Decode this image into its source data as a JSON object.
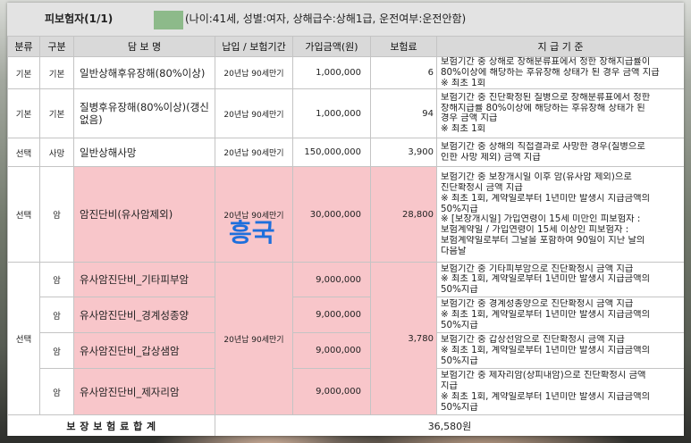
{
  "colors": {
    "band_bg": "#e3e3e3",
    "header_bg": "#d9d9d9",
    "highlight": "#f8c6ca",
    "redaction": "#8dba8a",
    "watermark": "#1e6fdc",
    "border": "#c4c4c4"
  },
  "insured": {
    "title": "피보험자(1/1)",
    "details": "(나이:41세, 성별:여자, 상해급수:상해1급, 운전여부:운전안함)"
  },
  "columns": {
    "category": "분류",
    "type": "구분",
    "coverage": "담 보 명",
    "term": "납입 / 보험기간",
    "amount": "가입금액(원)",
    "premium": "보험료",
    "criteria": "지 급 기 준"
  },
  "rows": [
    {
      "category": "기본",
      "type": "기본",
      "coverage": "일반상해후유장해(80%이상)",
      "term": "20년납 90세만기",
      "amount": "1,000,000",
      "premium": "6",
      "criteria": [
        "보험기간 중 상해로 장해분류표에서 정한 장해지급률이",
        "80%이상에 해당하는 후유장해 상태가 된 경우 금액 지급",
        "※ 최초 1회"
      ]
    },
    {
      "category": "기본",
      "type": "기본",
      "coverage": "질병후유장해(80%이상)(갱신없음)",
      "term": "20년납 90세만기",
      "amount": "1,000,000",
      "premium": "94",
      "criteria": [
        "보험기간 중 진단확정된 질병으로 장해분류표에서 정한",
        "장해지급률 80%이상에 해당하는 후유장해 상태가 된",
        "경우 금액 지급",
        "※ 최초 1회"
      ]
    },
    {
      "category": "선택",
      "type": "사망",
      "coverage": "일반상해사망",
      "term": "20년납 90세만기",
      "amount": "150,000,000",
      "premium": "3,900",
      "criteria": [
        "보험기간 중 상해의 직접결과로 사망한 경우(질병으로",
        "인한 사망 제외) 금액 지급"
      ]
    },
    {
      "category": "선택",
      "type": "암",
      "coverage": "암진단비(유사암제외)",
      "term": "20년납 90세만기",
      "amount": "30,000,000",
      "premium": "28,800",
      "criteria": [
        "보험기간 중 보장개시일 이후 암(유사암 제외)으로",
        "진단확정시 금액 지급",
        "※ 최초 1회, 계약일로부터 1년미만 발생시 지급금액의",
        "50%지급",
        "※ [보장개시일] 가입연령이 15세 미만인 피보험자 :",
        "보험계약일 / 가입연령이 15세 이상인 피보험자 :",
        "보험계약일로부터 그날을 포함하여 90일이 지난 날의",
        "다음날"
      ]
    }
  ],
  "group": {
    "category": "선택",
    "term": "20년납 90세만기",
    "premium": "3,780",
    "items": [
      {
        "type": "암",
        "coverage": "유사암진단비_기타피부암",
        "amount": "9,000,000",
        "criteria": [
          "보험기간 중 기타피부암으로 진단확정시 금액 지급",
          "※ 최초 1회, 계약일로부터 1년미만 발생시 지급금액의",
          "50%지급"
        ]
      },
      {
        "type": "암",
        "coverage": "유사암진단비_경계성종양",
        "amount": "9,000,000",
        "criteria": [
          "보험기간 중 경계성종양으로 진단확정시 금액 지급",
          "※ 최초 1회, 계약일로부터 1년미만 발생시 지급금액의",
          "50%지급"
        ]
      },
      {
        "type": "암",
        "coverage": "유사암진단비_갑상샘암",
        "amount": "9,000,000",
        "criteria": [
          "보험기간 중 갑상선암으로 진단확정시 금액 지급",
          "※ 최초 1회, 계약일로부터 1년미만 발생시 지급금액의",
          "50%지급"
        ]
      },
      {
        "type": "암",
        "coverage": "유사암진단비_제자리암",
        "amount": "9,000,000",
        "criteria": [
          "보험기간 중 제자리암(상피내암)으로 진단확정시 금액",
          "지급",
          "※ 최초 1회, 계약일로부터 1년미만 발생시 지급금액의",
          "50%지급"
        ]
      }
    ]
  },
  "watermark": "흥국",
  "total": {
    "label": "보 장 보 험 료 합 계",
    "value": "36,580원"
  }
}
